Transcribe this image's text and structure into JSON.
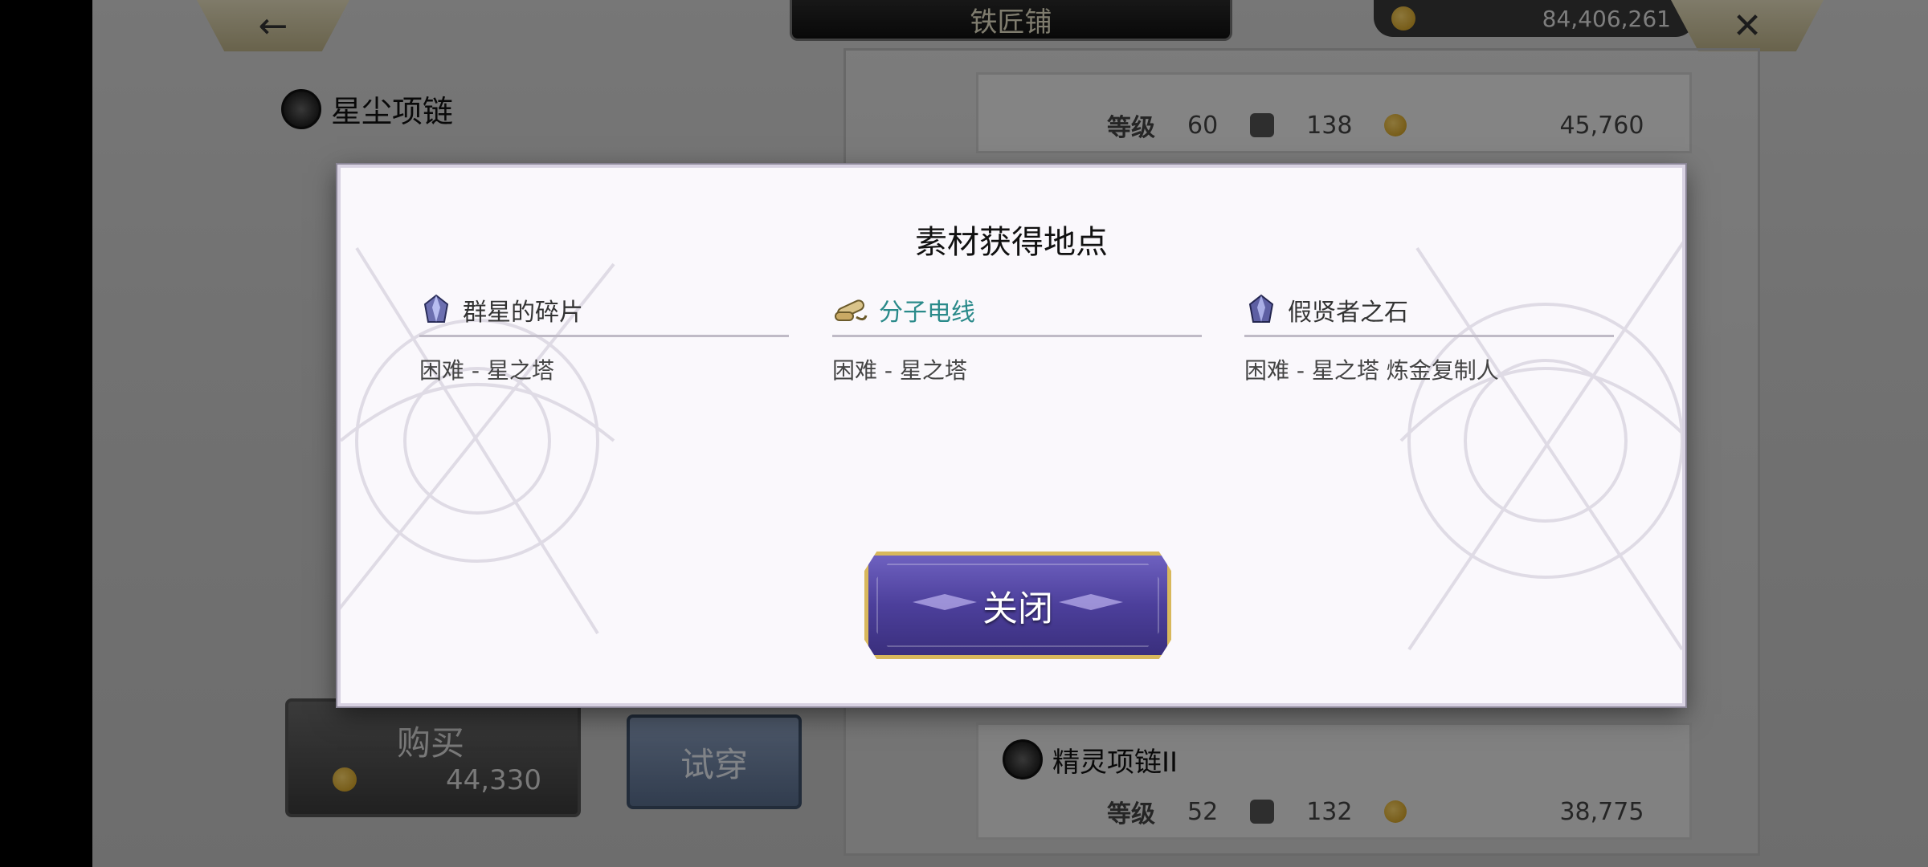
{
  "game": {
    "header": {
      "title": "铁匠铺",
      "back_icon": "←",
      "close_icon": "✕",
      "currency_amount": "84,406,261"
    },
    "item": {
      "name": "星尘项链"
    },
    "buy": {
      "label": "购买",
      "price": "44,330"
    },
    "try_on": {
      "label": "试穿"
    },
    "list": {
      "top_row": {
        "level_label": "等级",
        "level": "60",
        "defense": "138",
        "price": "45,760"
      },
      "bottom_row": {
        "name": "精灵项链II",
        "level_label": "等级",
        "level": "52",
        "defense": "132",
        "price": "38,775"
      }
    }
  },
  "modal": {
    "title": "素材获得地点",
    "materials": [
      {
        "name": "群星的碎片",
        "icon": "crystal-icon",
        "source": "困难 - 星之塔",
        "highlight": false
      },
      {
        "name": "分子电线",
        "icon": "wire-icon",
        "source": "困难 - 星之塔",
        "highlight": true
      },
      {
        "name": "假贤者之石",
        "icon": "crystal-icon",
        "source": "困难 - 星之塔 炼金复制人",
        "highlight": false
      }
    ],
    "close_label": "关闭"
  },
  "colors": {
    "accent_teal": "#2a8a8a",
    "button_purple": "#4c3f9b",
    "button_gold_border": "#d8b85c"
  }
}
